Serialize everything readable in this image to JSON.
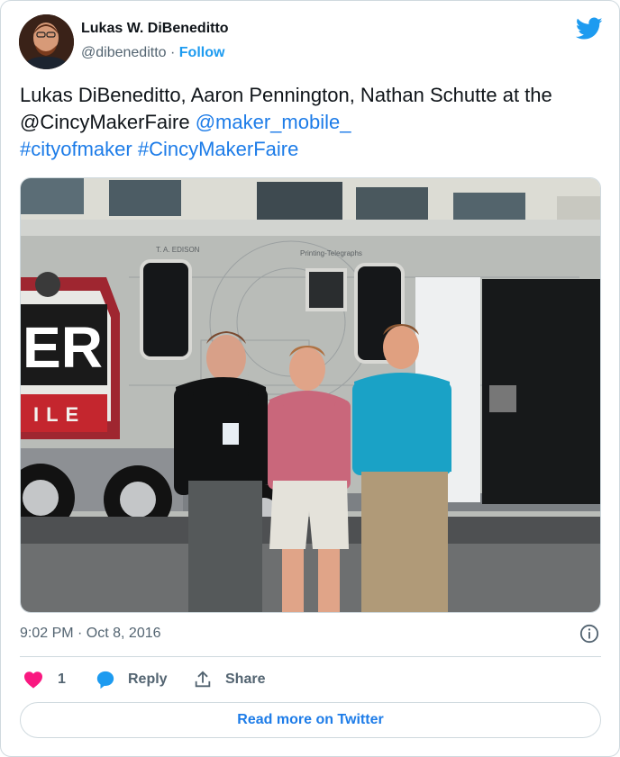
{
  "author": {
    "display_name": "Lukas W. DiBeneditto",
    "handle": "@dibeneditto",
    "separator": "·",
    "follow_label": "Follow"
  },
  "tweet": {
    "text_plain_1": "Lukas DiBeneditto, Aaron Pennington, Nathan Schutte at the @CincyMakerFaire ",
    "mention_1": "@maker_mobile_",
    "hashtag_1": "#cityofmaker",
    "hashtag_2": "#CincyMakerFaire"
  },
  "media": {
    "photo_text": {
      "sign_er": "ER",
      "sign_ile": "ILE",
      "plaque_1": "T. A. EDISON",
      "plaque_2": "Printing-Telegraphs"
    }
  },
  "meta": {
    "timestamp": "9:02 PM · Oct 8, 2016"
  },
  "actions": {
    "like_count": "1",
    "reply_label": "Reply",
    "share_label": "Share"
  },
  "footer": {
    "read_more_label": "Read more on Twitter"
  },
  "colors": {
    "link": "#1d7ce8",
    "brand": "#1d9bf0",
    "like": "#f91880",
    "muted": "#536471",
    "border": "#cfd9de"
  },
  "icons": {
    "brand": "twitter-bird-icon",
    "info": "info-icon",
    "like": "heart-icon",
    "reply": "speech-bubble-icon",
    "share": "share-upload-icon"
  }
}
